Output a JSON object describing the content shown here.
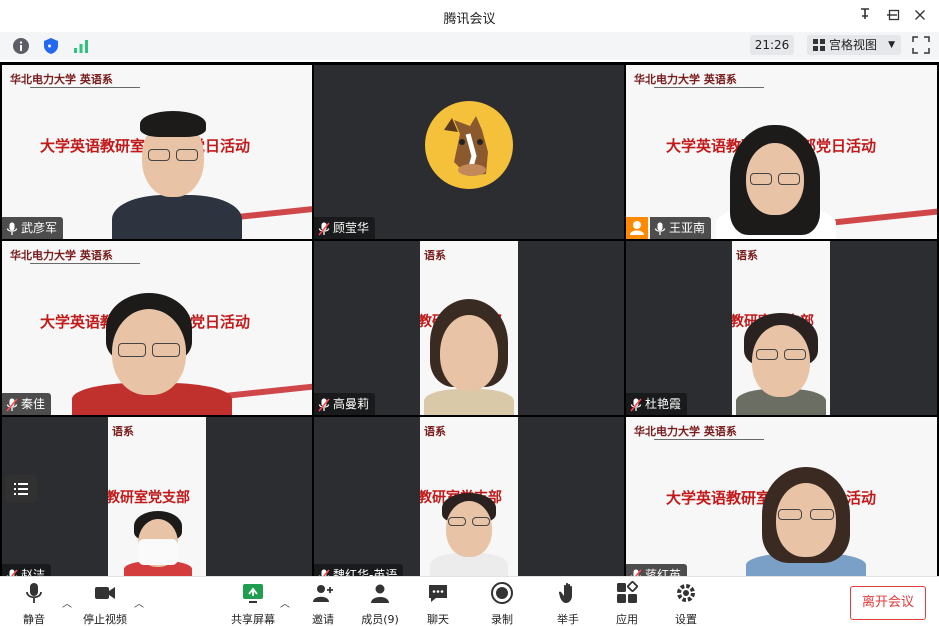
{
  "window": {
    "title": "腾讯会议"
  },
  "infobar": {
    "time": "21:26",
    "view_mode": "宫格视图"
  },
  "participants": [
    {
      "name": "武彦军",
      "slide": {
        "logo": "华北电力大学 英语系",
        "headline": "大学英语教研室党支部党日活动"
      }
    },
    {
      "name": "顾莹华"
    },
    {
      "name": "王亚南",
      "slide": {
        "logo": "华北电力大学 英语系",
        "headline": "大学英语教研室党支部党日活动"
      }
    },
    {
      "name": "秦佳",
      "slide": {
        "logo": "华北电力大学 英语系",
        "headline": "大学英语教研室党支部党日活动"
      }
    },
    {
      "name": "高曼莉",
      "slide": {
        "logo": "语系",
        "headline": "教研室党支部"
      }
    },
    {
      "name": "杜艳霞",
      "slide": {
        "logo": "语系",
        "headline": "教研室党支部"
      }
    },
    {
      "name": "赵洁",
      "slide": {
        "logo": "语系",
        "headline": "教研室党支部"
      }
    },
    {
      "name": "魏红华-英语",
      "slide": {
        "logo": "语系",
        "headline": "教研室党支部"
      }
    },
    {
      "name": "蒋红英",
      "slide": {
        "logo": "华北电力大学 英语系",
        "headline": "大学英语教研室党支部党日活动"
      }
    }
  ],
  "toolbar": {
    "mute": "静音",
    "stop_video": "停止视频",
    "share_screen": "共享屏幕",
    "invite": "邀请",
    "members": "成员(9)",
    "chat": "聊天",
    "record": "录制",
    "raise_hand": "举手",
    "apps": "应用",
    "settings": "设置",
    "leave": "离开会议"
  },
  "colors": {
    "accent_green": "#2ec27e",
    "leave_red": "#e03a3a",
    "host_orange": "#ff8a00"
  }
}
